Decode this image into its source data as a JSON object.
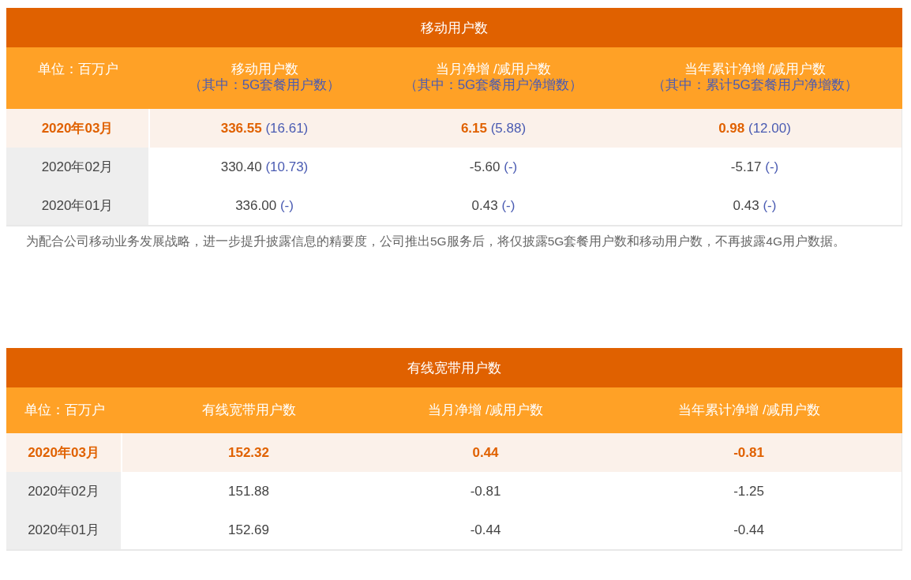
{
  "tables": [
    {
      "title": "移动用户数",
      "columns": [
        {
          "label": "单位：百万户"
        },
        {
          "label": "移动用户数",
          "sublabel": "（其中：5G套餐用户数）"
        },
        {
          "label": "当月净增 /减用户数",
          "sublabel": "（其中：5G套餐用户净增数）"
        },
        {
          "label": "当年累计净增 /减用户数",
          "sublabel": "（其中：累计5G套餐用户净增数）"
        }
      ],
      "rows": [
        {
          "highlighted": true,
          "cells": [
            {
              "value": "2020年03月"
            },
            {
              "value": "336.55",
              "sub": "(16.61)"
            },
            {
              "value": "6.15",
              "sub": "(5.88)"
            },
            {
              "value": "0.98",
              "sub": "(12.00)"
            }
          ]
        },
        {
          "highlighted": false,
          "cells": [
            {
              "value": "2020年02月"
            },
            {
              "value": "330.40",
              "sub": "(10.73)"
            },
            {
              "value": "-5.60",
              "sub": "(-)"
            },
            {
              "value": "-5.17",
              "sub": "(-)"
            }
          ]
        },
        {
          "highlighted": false,
          "cells": [
            {
              "value": "2020年01月"
            },
            {
              "value": "336.00",
              "sub": "(-)"
            },
            {
              "value": "0.43",
              "sub": "(-)"
            },
            {
              "value": "0.43",
              "sub": "(-)"
            }
          ]
        }
      ],
      "note": "为配合公司移动业务发展战略，进一步提升披露信息的精要度，公司推出5G服务后，将仅披露5G套餐用户数和移动用户数，不再披露4G用户数据。"
    },
    {
      "title": "有线宽带用户数",
      "columns": [
        {
          "label": "单位：百万户"
        },
        {
          "label": "有线宽带用户数"
        },
        {
          "label": "当月净增 /减用户数"
        },
        {
          "label": "当年累计净增 /减用户数"
        }
      ],
      "rows": [
        {
          "highlighted": true,
          "cells": [
            {
              "value": "2020年03月"
            },
            {
              "value": "152.32"
            },
            {
              "value": "0.44"
            },
            {
              "value": "-0.81"
            }
          ]
        },
        {
          "highlighted": false,
          "cells": [
            {
              "value": "2020年02月"
            },
            {
              "value": "151.88"
            },
            {
              "value": "-0.81"
            },
            {
              "value": "-1.25"
            }
          ]
        },
        {
          "highlighted": false,
          "cells": [
            {
              "value": "2020年01月"
            },
            {
              "value": "152.69"
            },
            {
              "value": "-0.44"
            },
            {
              "value": "-0.44"
            }
          ]
        }
      ]
    }
  ]
}
